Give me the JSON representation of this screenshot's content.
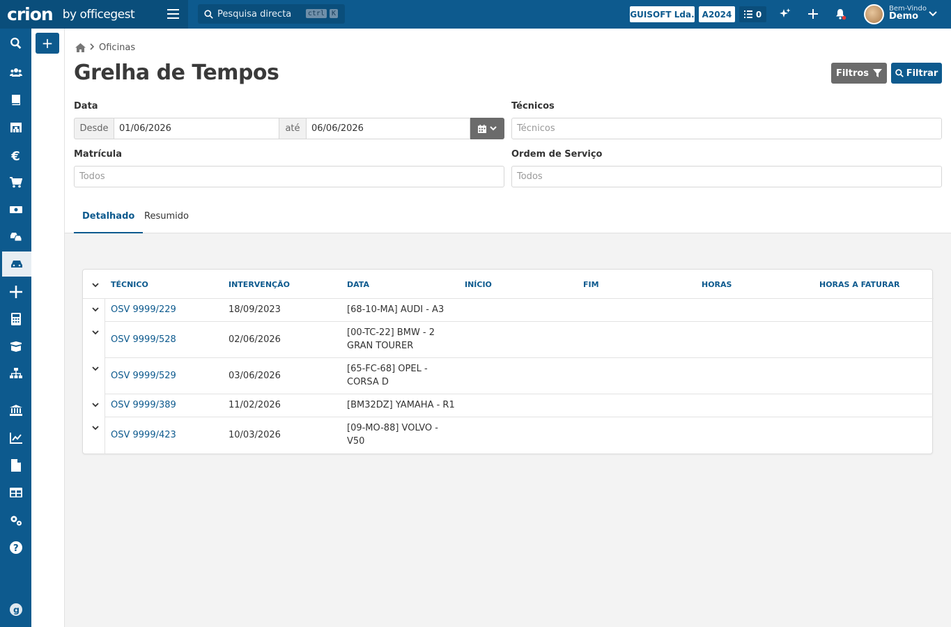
{
  "topbar": {
    "brand": "crion",
    "brand_suffix": "by officegest",
    "search_placeholder": "Pesquisa directa",
    "search_kbd_1": "ctrl",
    "search_kbd_2": "K",
    "company": "GUISOFT Lda.",
    "year": "A2024",
    "tasks_count": "0",
    "welcome_label": "Bem-Vindo",
    "user_name": "Demo"
  },
  "breadcrumb": {
    "section": "Oficinas"
  },
  "page": {
    "title": "Grelha de Tempos",
    "btn_filtros": "Filtros",
    "btn_filtrar": "Filtrar"
  },
  "filters": {
    "data_label": "Data",
    "desde_label": "Desde",
    "desde_value": "01/06/2026",
    "ate_label": "até",
    "ate_value": "06/06/2026",
    "tecnicos_label": "Técnicos",
    "tecnicos_placeholder": "Técnicos",
    "matricula_label": "Matrícula",
    "matricula_placeholder": "Todos",
    "os_label": "Ordem de Serviço",
    "os_placeholder": "Todos"
  },
  "tabs": [
    {
      "label": "Detalhado",
      "active": true
    },
    {
      "label": "Resumido",
      "active": false
    }
  ],
  "table": {
    "headers": [
      "Técnico",
      "Intervenção",
      "Data",
      "Início",
      "Fim",
      "Horas",
      "Horas a faturar"
    ],
    "rows": [
      {
        "tecnico": "OSV 9999/229",
        "intervencao": "18/09/2023",
        "data_l1": "[68-10-MA] AUDI - A3",
        "data_l2": ""
      },
      {
        "tecnico": "OSV 9999/528",
        "intervencao": "02/06/2026",
        "data_l1": "[00-TC-22] BMW - 2",
        "data_l2": "GRAN TOURER"
      },
      {
        "tecnico": "OSV 9999/529",
        "intervencao": "03/06/2026",
        "data_l1": "[65-FC-68] OPEL -",
        "data_l2": "CORSA D"
      },
      {
        "tecnico": "OSV 9999/389",
        "intervencao": "11/02/2026",
        "data_l1": "[BM32DZ] YAMAHA - R1",
        "data_l2": ""
      },
      {
        "tecnico": "OSV 9999/423",
        "intervencao": "10/03/2026",
        "data_l1": "[09-MO-88] VOLVO -",
        "data_l2": "V50"
      }
    ]
  },
  "colors": {
    "primary": "#0d5a8e",
    "primary_dark": "#0a4e7b",
    "grey_button": "#6b6b6b"
  }
}
